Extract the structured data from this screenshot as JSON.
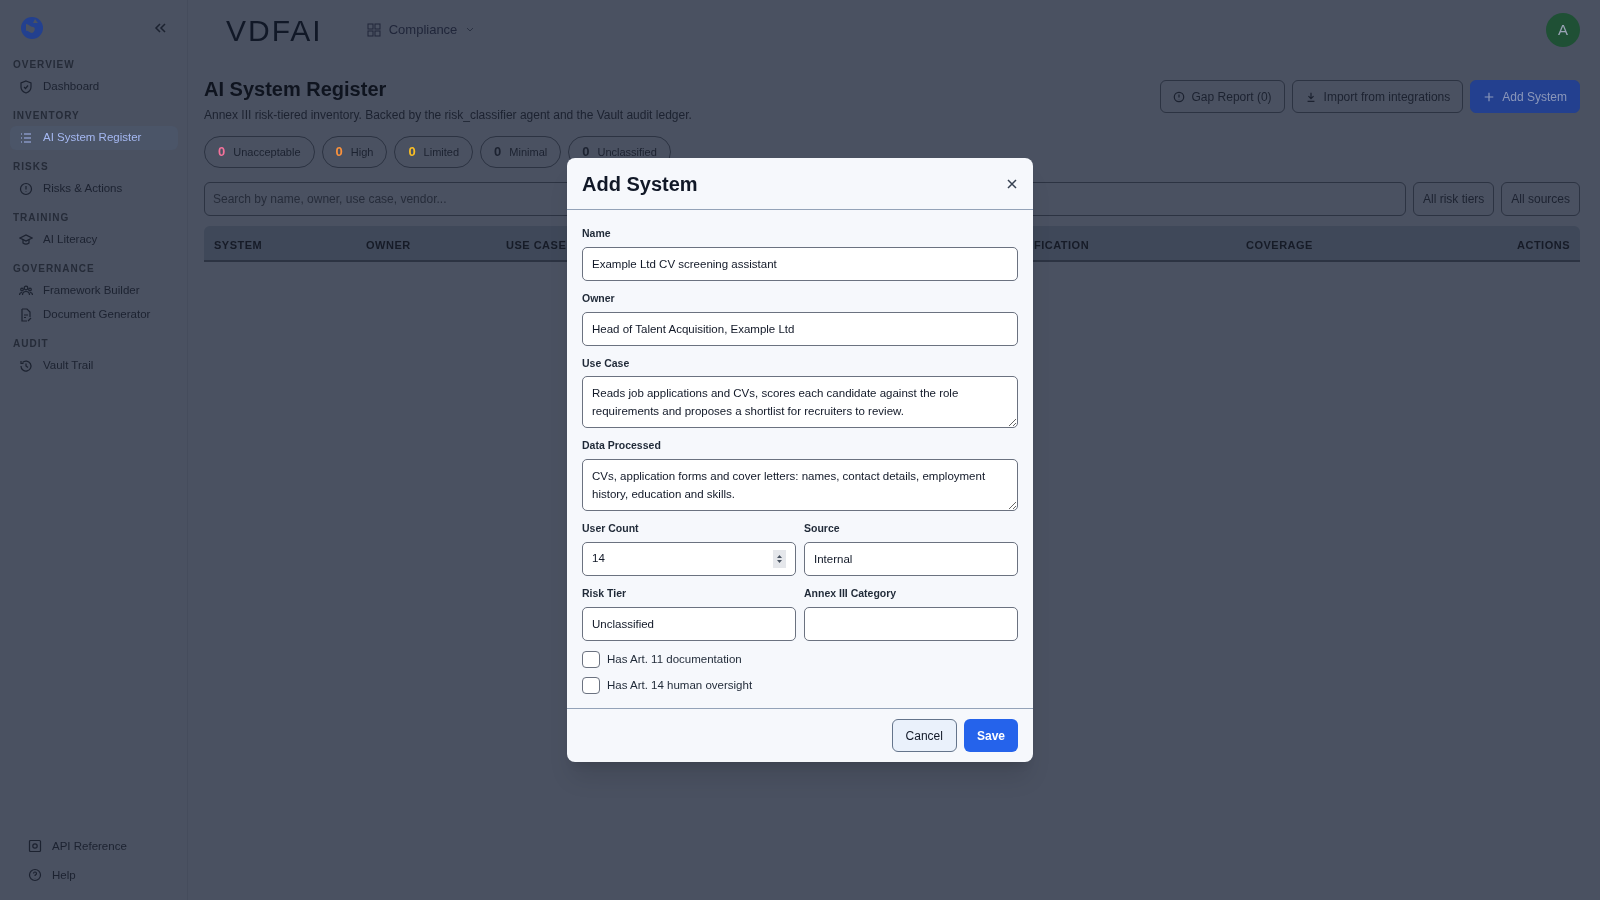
{
  "logo": "VDFAI",
  "workspace": "Compliance",
  "avatar": "A",
  "sidebar": [
    {
      "heading": "OVERVIEW",
      "items": [
        {
          "label": "Dashboard",
          "selected": false
        }
      ]
    },
    {
      "heading": "INVENTORY",
      "items": [
        {
          "label": "AI System Register",
          "selected": true
        }
      ]
    },
    {
      "heading": "RISKS",
      "items": [
        {
          "label": "Risks & Actions",
          "selected": false
        }
      ]
    },
    {
      "heading": "TRAINING",
      "items": [
        {
          "label": "AI Literacy",
          "selected": false
        }
      ]
    },
    {
      "heading": "GOVERNANCE",
      "items": [
        {
          "label": "Framework Builder",
          "selected": false
        },
        {
          "label": "Document Generator",
          "selected": false
        }
      ]
    },
    {
      "heading": "AUDIT",
      "items": [
        {
          "label": "Vault Trail",
          "selected": false
        }
      ]
    }
  ],
  "sidebar_footer": [
    "API Reference",
    "Help"
  ],
  "page": {
    "title": "AI System Register",
    "subtitle": "Annex III risk-tiered inventory. Backed by the risk_classifier agent and the Vault audit ledger.",
    "actions": [
      {
        "label": "Gap Report (0)",
        "kind": "outline"
      },
      {
        "label": "Import from integrations",
        "kind": "outline"
      },
      {
        "label": "Add System",
        "kind": "primary"
      }
    ],
    "tiers": [
      {
        "count": "0",
        "label": "Unacceptable",
        "color": "#f4729b"
      },
      {
        "count": "0",
        "label": "High",
        "color": "#fb923c"
      },
      {
        "count": "0",
        "label": "Limited",
        "color": "#fbbf24"
      },
      {
        "count": "0",
        "label": "Minimal",
        "color": "#1c2230"
      },
      {
        "count": "0",
        "label": "Unclassified",
        "color": "#1c2230"
      }
    ],
    "search": {
      "placeholder": "Search by name, owner, use case, vendor..."
    },
    "filters": [
      "All risk tiers",
      "All sources"
    ],
    "columns": [
      "SYSTEM",
      "OWNER",
      "USE CASE",
      "FICATION",
      "COVERAGE",
      "ACTIONS"
    ]
  },
  "modal": {
    "title": "Add System",
    "rows": [
      [
        {
          "label": "Name",
          "value": "Example Ltd CV screening assistant",
          "kind": "text"
        }
      ],
      [
        {
          "label": "Owner",
          "value": "Head of Talent Acquisition, Example Ltd",
          "kind": "text"
        }
      ],
      [
        {
          "label": "Use Case",
          "value": "Reads job applications and CVs, scores each candidate against the role requirements and proposes a shortlist for recruiters to review.",
          "kind": "textarea"
        }
      ],
      [
        {
          "label": "Data Processed",
          "value": "CVs, application forms and cover letters: names, contact details, employment history, education and skills.",
          "kind": "textarea"
        }
      ],
      [
        {
          "label": "User Count",
          "value": "14",
          "kind": "number"
        },
        {
          "label": "Source",
          "value": "Internal",
          "kind": "text"
        }
      ],
      [
        {
          "label": "Risk Tier",
          "value": "Unclassified",
          "kind": "text"
        },
        {
          "label": "Annex III Category",
          "kind": "text"
        }
      ]
    ],
    "checks": [
      {
        "label": "Has Art. 11 documentation",
        "checked": false
      },
      {
        "label": "Has Art. 14 human oversight",
        "checked": false
      }
    ],
    "buttons": [
      {
        "label": "Cancel",
        "kind": "secondary"
      },
      {
        "label": "Save",
        "kind": "primary"
      }
    ]
  }
}
